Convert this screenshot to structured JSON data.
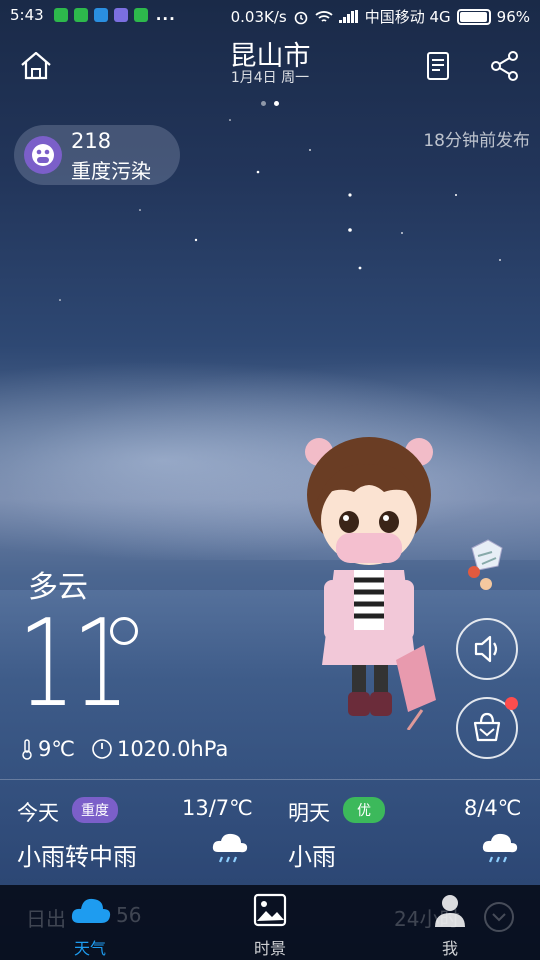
{
  "status_bar": {
    "time": "5:43",
    "dots": "...",
    "net_speed": "0.03K/s",
    "carrier": "中国移动 4G",
    "battery": "96%"
  },
  "header": {
    "city": "昆山市",
    "date": "1月4日 周一",
    "page_count": 2,
    "active_page": 1,
    "icons": [
      "home-icon",
      "document-icon",
      "share-icon"
    ]
  },
  "aqi": {
    "value": "218",
    "label": "重度污染",
    "color": "#7b5fc9"
  },
  "published": "18分钟前发布",
  "current": {
    "condition": "多云",
    "temperature": "11",
    "feels_like": "9℃",
    "pressure": "1020.0hPa"
  },
  "side_buttons": [
    {
      "icon": "speaker-icon"
    },
    {
      "icon": "wardrobe-bag-icon",
      "has_badge": true,
      "badge_color": "#ff4d4d"
    }
  ],
  "forecast": {
    "today": {
      "day": "今天",
      "tag": "重度",
      "tag_color": "#7b5fc9",
      "range": "13/7℃",
      "desc": "小雨转中雨",
      "icon": "rain-cloud-icon"
    },
    "tomorrow": {
      "day": "明天",
      "tag": "优",
      "tag_color": "#3cb95b",
      "range": "8/4℃",
      "desc": "小雨",
      "icon": "rain-cloud-icon"
    }
  },
  "bottom_nav": {
    "ghost_left": "日出",
    "ghost_left_value": "56",
    "ghost_right": "24小时",
    "items": [
      {
        "label": "天气",
        "icon": "cloud-icon",
        "active": true
      },
      {
        "label": "时景",
        "icon": "photo-icon",
        "active": false
      },
      {
        "label": "我",
        "icon": "person-icon",
        "active": false
      }
    ],
    "active_color": "#1e9cf0"
  }
}
